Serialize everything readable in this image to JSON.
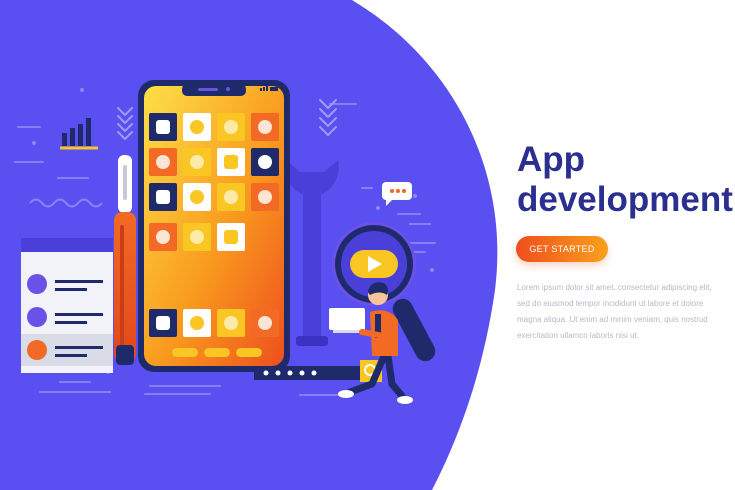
{
  "hero": {
    "title_line1": "App",
    "title_line2": "development",
    "cta_label": "GET STARTED",
    "body_text": "Lorem ipsum dolor sit amet, consectetur adipiscing elit, sed do eiusmod tempor incididunt ut labore et dolore magna aliqua. Ut enim ad minim veniam, quis nostrud exercitation ullamco laboris nisi ut."
  },
  "colors": {
    "blob": "#5a4ff0",
    "title": "#2b2f8f",
    "accent_orange": "#f26a24",
    "accent_yellow": "#f9c623",
    "navy": "#1f2a6b",
    "body_text": "#b5b9c9"
  },
  "illustration": {
    "icons": [
      "bar-chart-icon",
      "chevron-down-icon",
      "chevron-down-icon",
      "wave-icon",
      "screwdriver-icon",
      "wrench-icon",
      "chat-bubble-icon",
      "magnifier-icon",
      "play-icon",
      "search-icon",
      "settings-card-icon",
      "smartphone-icon",
      "person-with-laptop-icon"
    ]
  }
}
